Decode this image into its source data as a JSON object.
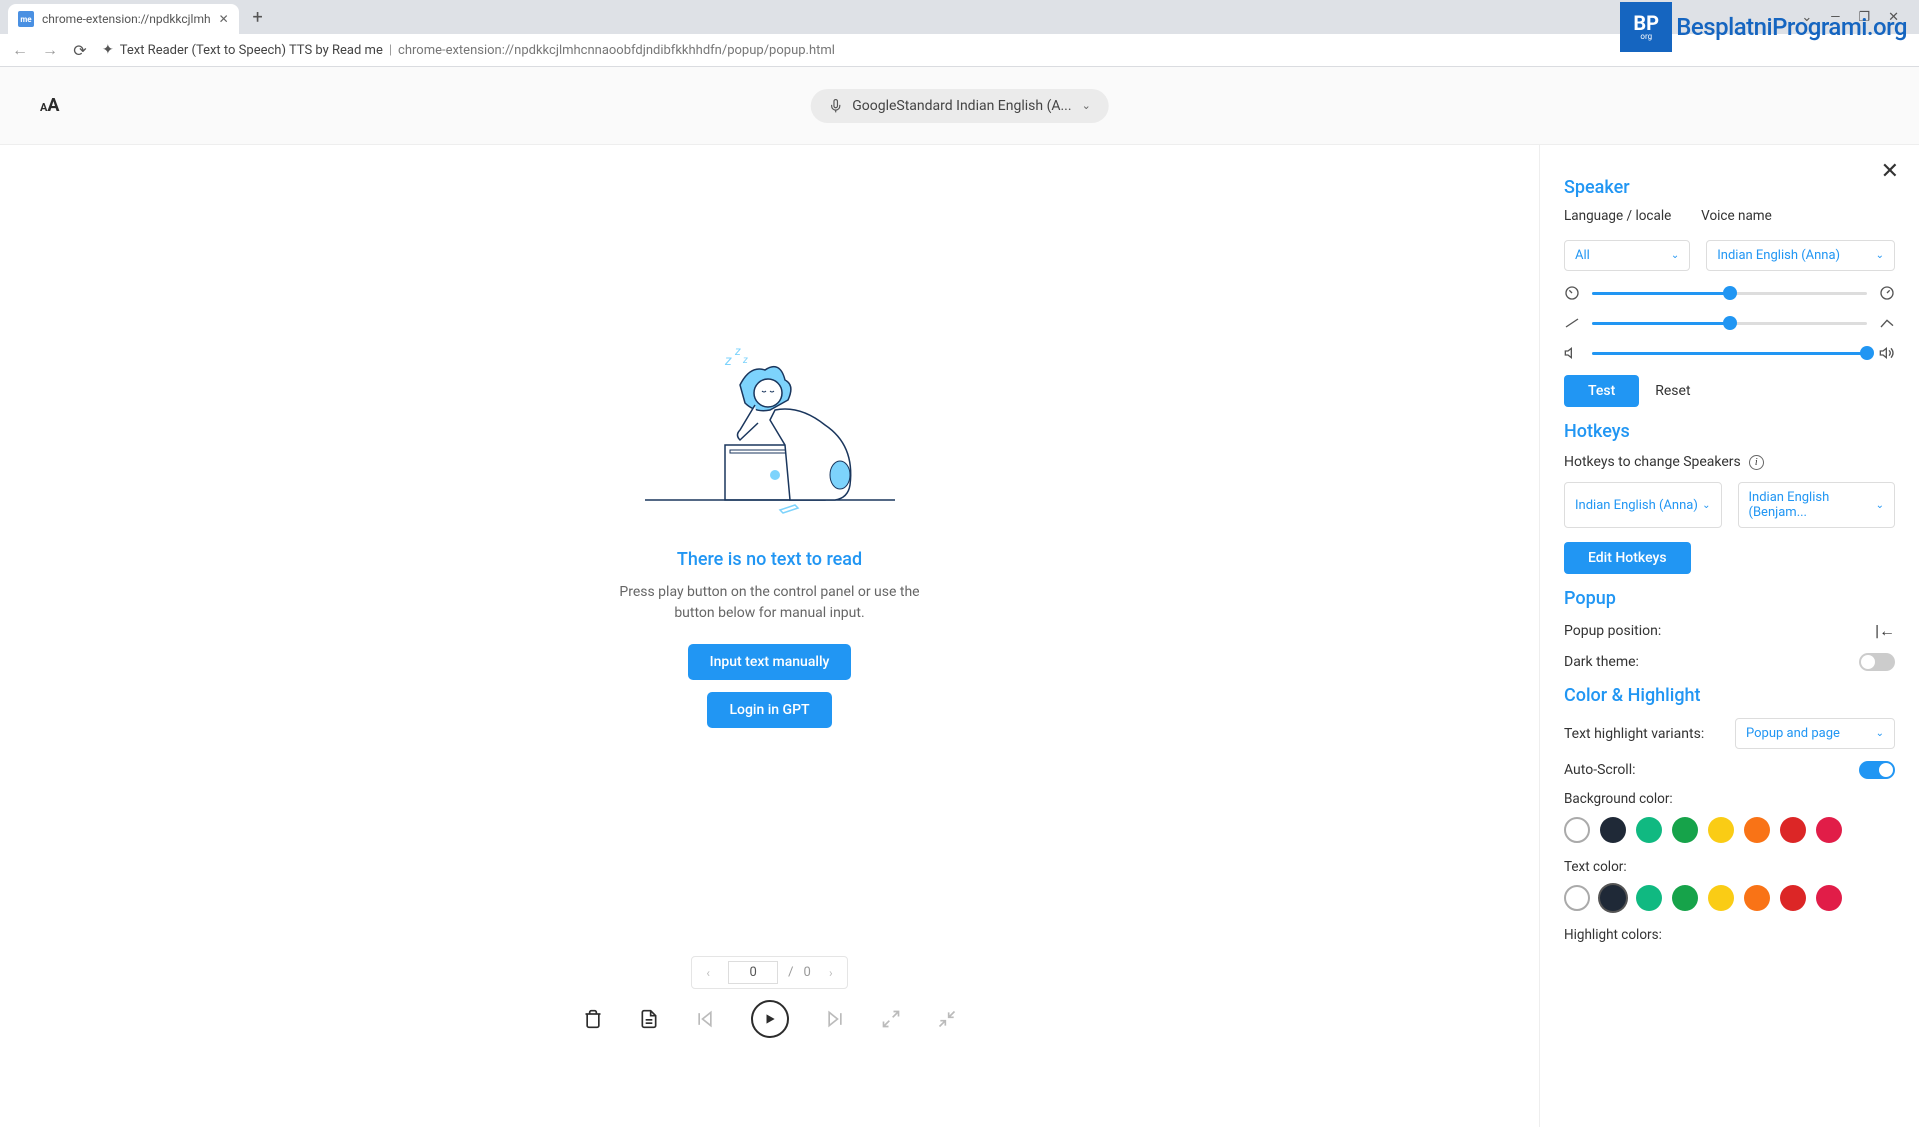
{
  "browser": {
    "tab_title": "chrome-extension://npdkkcjlmh",
    "new_tab": "+",
    "minimize": "—",
    "maximize": "❐",
    "close": "✕",
    "url_title": "Text Reader (Text to Speech) TTS by Read me",
    "url_path": "chrome-extension://npdkkcjlmhcnnaoobfdjndibfkkhhdfn/popup/popup.html"
  },
  "watermark": {
    "logo_letters": "BP",
    "logo_sub": "org",
    "text": "BesplatniProgrami.org"
  },
  "appbar": {
    "voice": "GoogleStandard Indian English (A..."
  },
  "empty": {
    "title": "There is no text to read",
    "subtitle": "Press play button on the control panel or use the button below for manual input.",
    "input_btn": "Input text manually",
    "login_btn": "Login in GPT"
  },
  "pagination": {
    "current": "0",
    "sep": "/",
    "total": "0"
  },
  "settings": {
    "speaker_title": "Speaker",
    "lang_label": "Language / locale",
    "voice_label": "Voice name",
    "lang_value": "All",
    "voice_value": "Indian English (Anna)",
    "sliders": {
      "speed": 50,
      "pitch": 50,
      "volume": 100
    },
    "test_btn": "Test",
    "reset_btn": "Reset",
    "hotkeys_title": "Hotkeys",
    "hotkeys_label": "Hotkeys to change Speakers",
    "hotkey1": "Indian English (Anna)",
    "hotkey2": "Indian English (Benjam...",
    "edit_hotkeys_btn": "Edit Hotkeys",
    "popup_title": "Popup",
    "popup_position": "Popup position:",
    "dark_theme": "Dark theme:",
    "color_title": "Color & Highlight",
    "highlight_variants": "Text highlight variants:",
    "highlight_value": "Popup and page",
    "auto_scroll": "Auto-Scroll:",
    "bg_color": "Background color:",
    "text_color": "Text color:",
    "highlight_colors": "Highlight colors:",
    "colors": [
      "#ffffff",
      "#1f2937",
      "#10b981",
      "#16a34a",
      "#facc15",
      "#f97316",
      "#dc2626",
      "#e11d48"
    ]
  }
}
